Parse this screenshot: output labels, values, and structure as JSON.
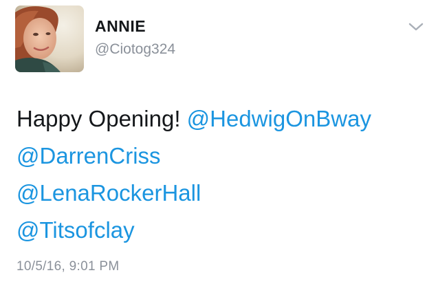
{
  "author": {
    "display_name": "ANNIE",
    "handle": "@Ciotog324",
    "avatar_icon": "profile-photo"
  },
  "tweet": {
    "text": "Happy Opening!",
    "mentions": [
      "@HedwigOnBway",
      "@DarrenCriss",
      "@LenaRockerHall",
      "@Titsofclay"
    ],
    "timestamp": "10/5/16, 9:01 PM"
  },
  "menu_icon": "chevron-down-icon",
  "colors": {
    "link": "#1b95e0",
    "text": "#14171a",
    "muted": "#8a9099"
  }
}
